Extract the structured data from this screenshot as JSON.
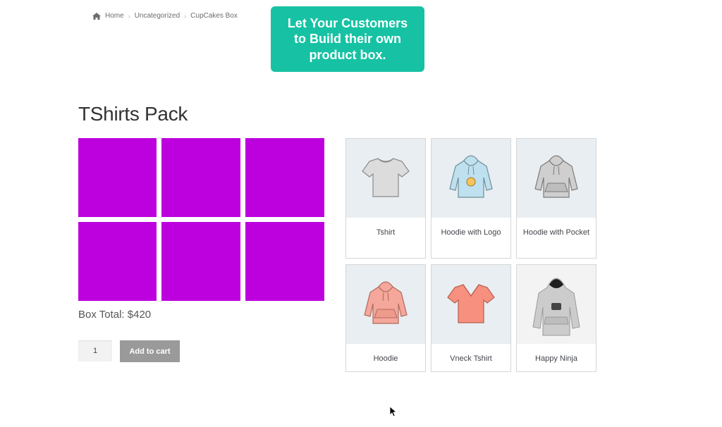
{
  "breadcrumb": {
    "items": [
      "Home",
      "Uncategorized",
      "CupCakes Box"
    ]
  },
  "promo": {
    "line1": "Let Your Customers",
    "line2": "to Build their own",
    "line3": "product box."
  },
  "page_title": "TShirts Pack",
  "box": {
    "slots": 6,
    "slot_color": "#bd00de",
    "total_label": "Box Total: $420"
  },
  "cart": {
    "quantity": "1",
    "add_label": "Add to cart"
  },
  "products": [
    {
      "name": "Tshirt",
      "icon": "tshirt-icon"
    },
    {
      "name": "Hoodie with Logo",
      "icon": "hoodie-logo-icon"
    },
    {
      "name": "Hoodie with Pocket",
      "icon": "hoodie-pocket-icon"
    },
    {
      "name": "Hoodie",
      "icon": "hoodie-icon"
    },
    {
      "name": "Vneck Tshirt",
      "icon": "vneck-tshirt-icon"
    },
    {
      "name": "Happy Ninja",
      "icon": "ninja-hoodie-icon"
    }
  ],
  "colors": {
    "accent": "#16c2a3",
    "button": "#9a9a9a"
  }
}
